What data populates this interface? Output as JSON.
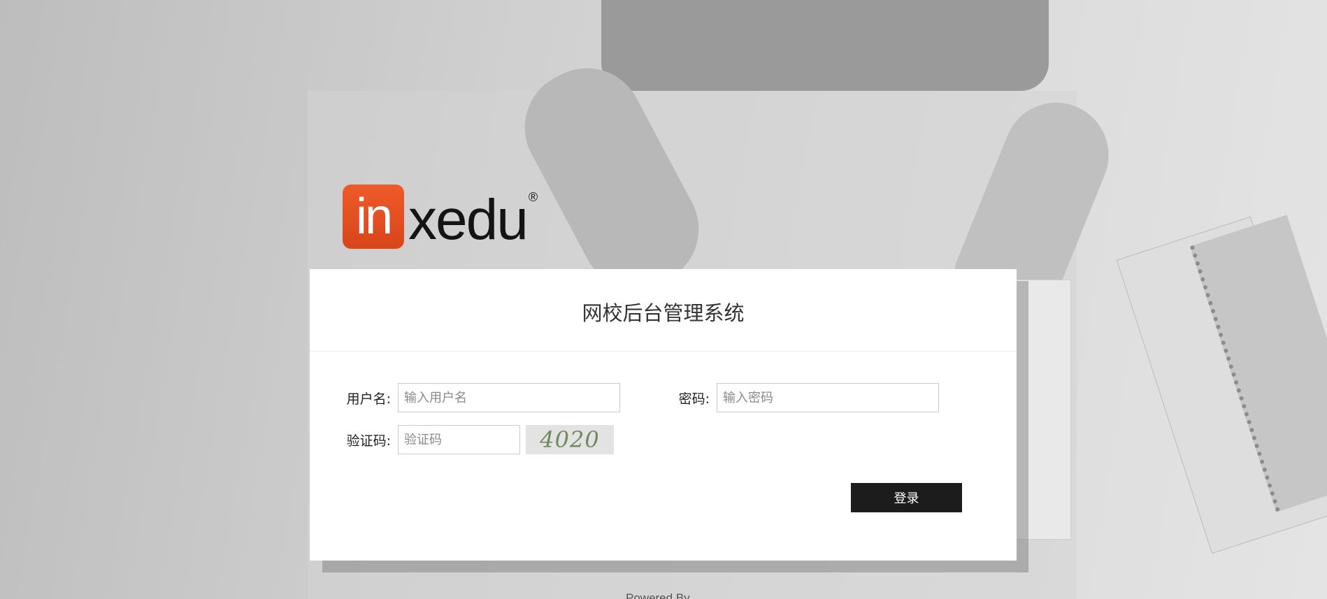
{
  "logo": {
    "brand_badge": "in",
    "brand_text": "xedu",
    "registered_mark": "®"
  },
  "login": {
    "title": "网校后台管理系统",
    "username_label": "用户名:",
    "username_placeholder": "输入用户名",
    "password_label": "密码:",
    "password_placeholder": "输入密码",
    "captcha_label": "验证码:",
    "captcha_placeholder": "验证码",
    "captcha_text": "4020",
    "submit_label": "登录"
  },
  "footer": {
    "text": "Powered By..."
  },
  "colors": {
    "logo_accent": "#e4502a",
    "button_bg": "#1c1c1c",
    "card_bg": "#ffffff"
  }
}
